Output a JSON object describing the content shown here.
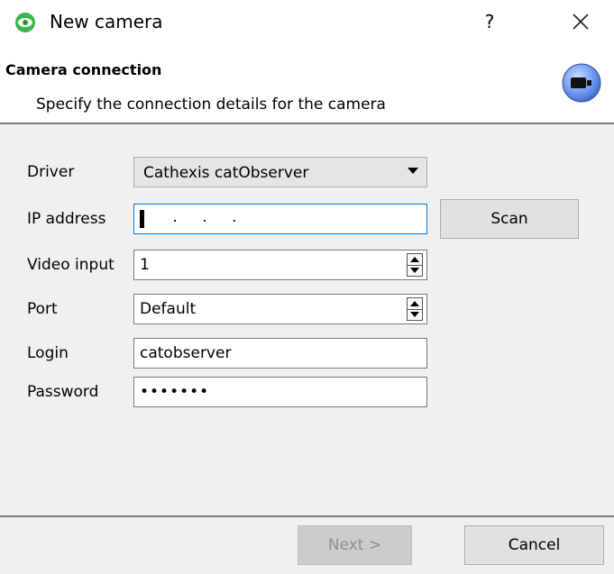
{
  "window": {
    "title": "New camera",
    "help_label": "?",
    "icon": "green-eye-icon",
    "close_icon": "close-icon"
  },
  "header": {
    "title": "Camera connection",
    "subtitle": "Specify the connection details for the camera",
    "icon": "camera-icon"
  },
  "form": {
    "driver": {
      "label": "Driver",
      "value": "Cathexis catObserver"
    },
    "ip_address": {
      "label": "IP address",
      "value": " . . ."
    },
    "video_input": {
      "label": "Video input",
      "value": "1"
    },
    "port": {
      "label": "Port",
      "value": "Default"
    },
    "login": {
      "label": "Login",
      "value": "catobserver"
    },
    "password": {
      "label": "Password",
      "value": "•••••••"
    }
  },
  "buttons": {
    "scan": "Scan",
    "next": "Next >",
    "cancel": "Cancel"
  },
  "colors": {
    "accent": "#0078d7",
    "brand_green": "#3cb54a",
    "content_bg": "#f0f0f0"
  }
}
